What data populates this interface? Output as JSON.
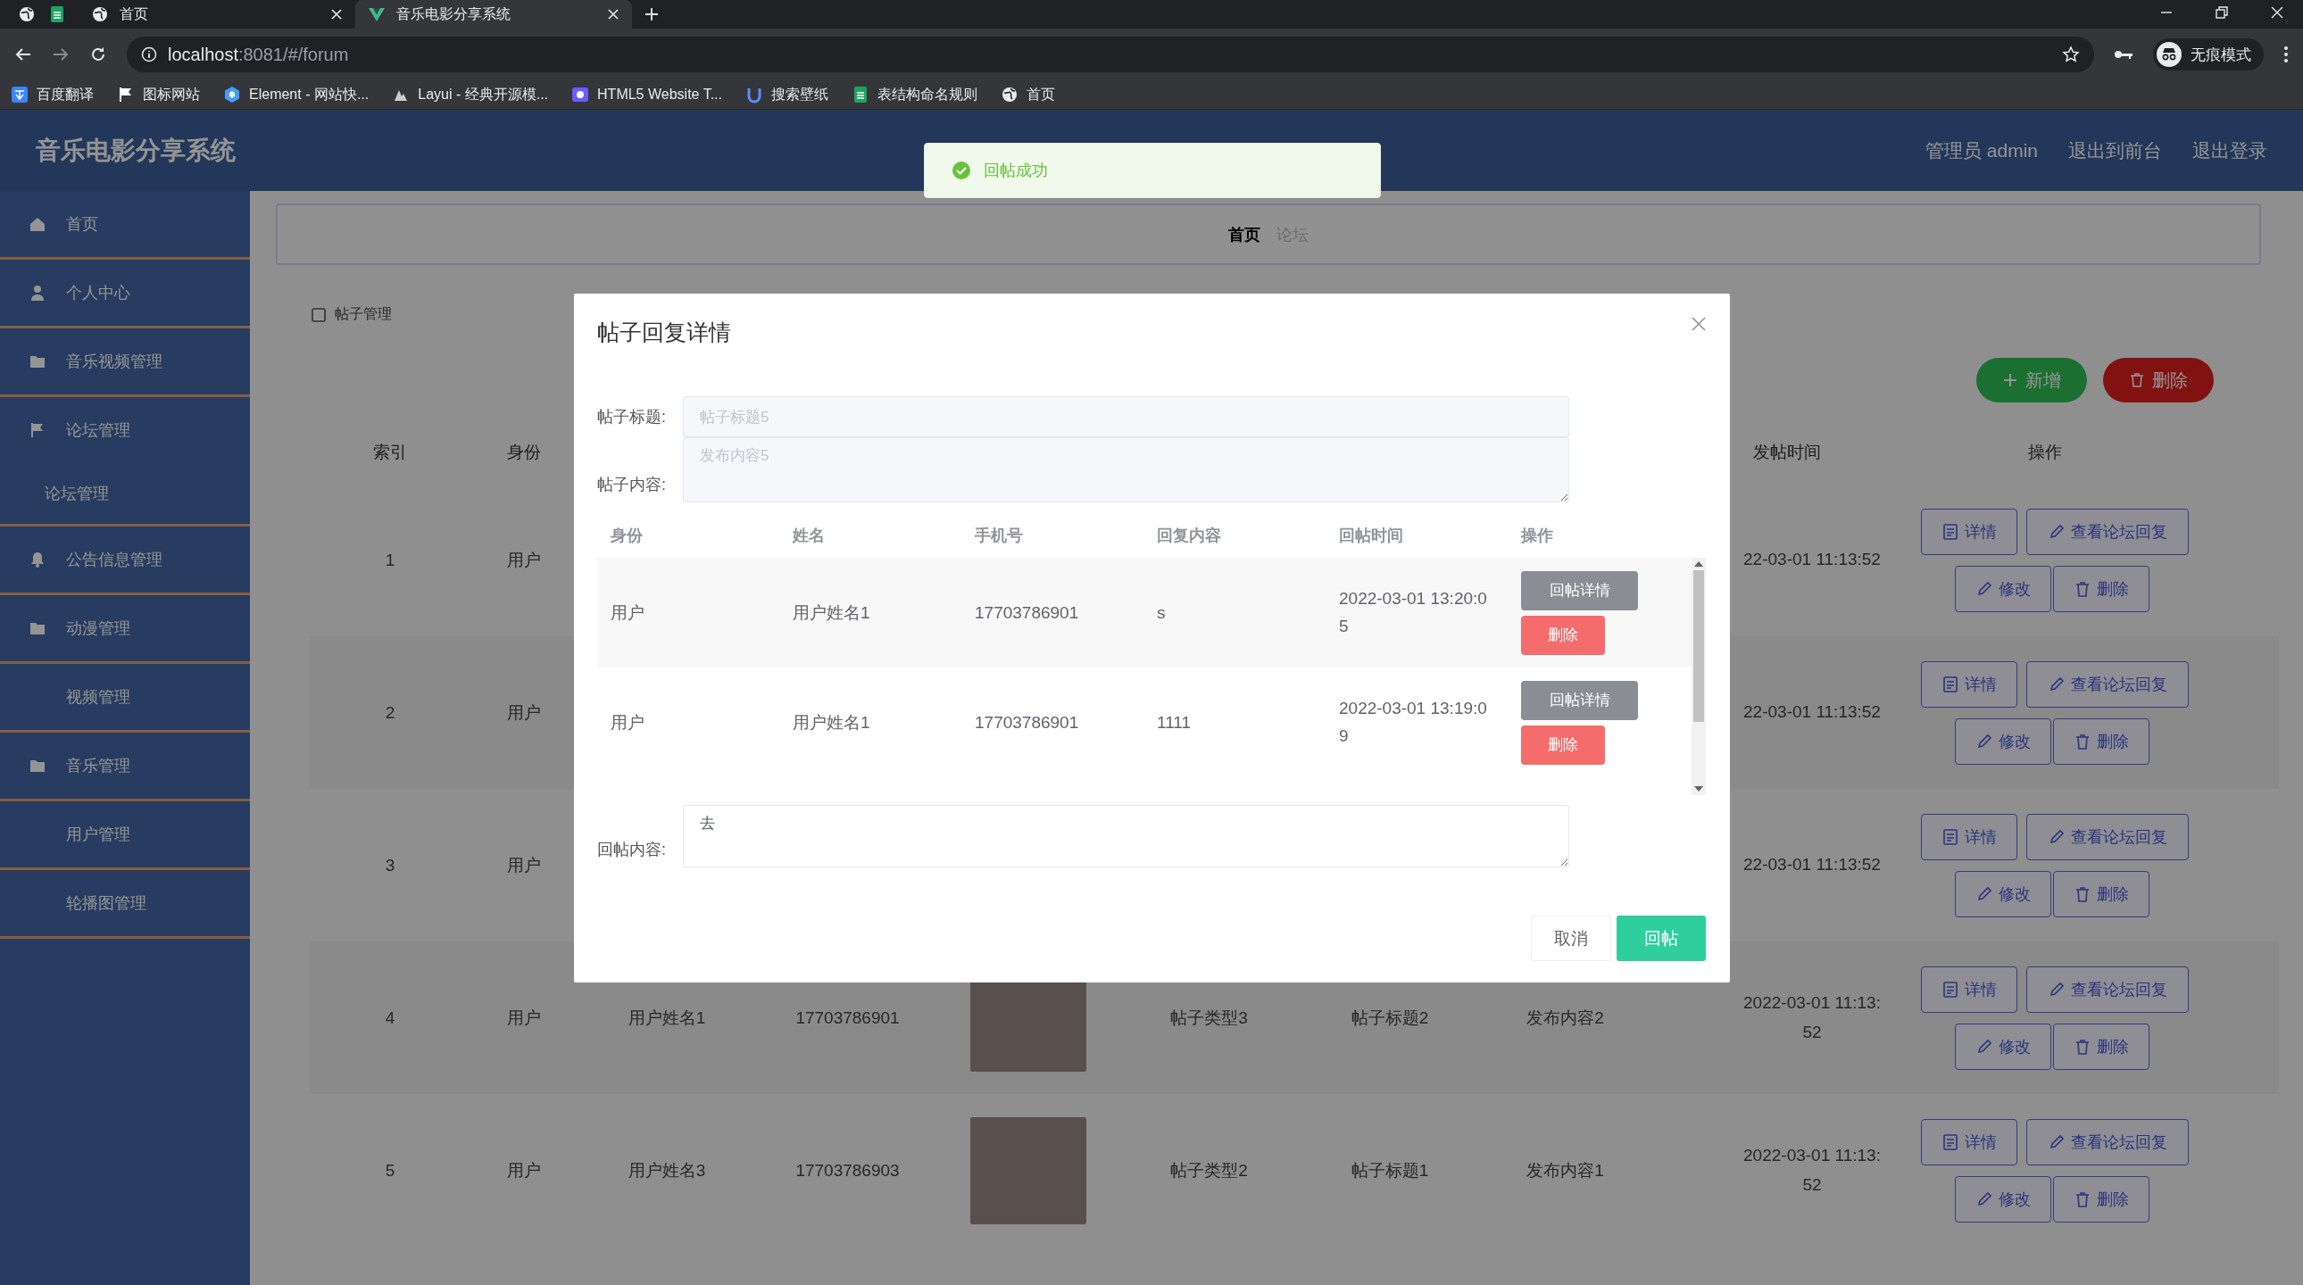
{
  "browser": {
    "tabs": [
      {
        "title": "首页",
        "selected": false
      },
      {
        "title": "音乐电影分享系统",
        "selected": true
      }
    ],
    "url": {
      "host": "localhost",
      "path": ":8081/#/forum"
    },
    "bookmarks": [
      "百度翻译",
      "图标网站",
      "Element - 网站快...",
      "Layui - 经典开源模...",
      "HTML5 Website T...",
      "搜索壁纸",
      "表结构命名规则",
      "首页"
    ],
    "profile": "无痕模式"
  },
  "app": {
    "title": "音乐电影分享系统",
    "header_links": [
      "管理员 admin",
      "退出到前台",
      "退出登录"
    ]
  },
  "toast": {
    "kind": "success",
    "message": "回帖成功"
  },
  "sidebar": {
    "items": [
      {
        "label": "首页"
      },
      {
        "label": "个人中心"
      },
      {
        "label": "音乐视频管理"
      },
      {
        "label": "论坛管理",
        "expanded": true,
        "children": [
          {
            "label": "论坛管理"
          }
        ]
      },
      {
        "label": "公告信息管理"
      },
      {
        "label": "动漫管理"
      },
      {
        "label": "视频管理"
      },
      {
        "label": "音乐管理"
      },
      {
        "label": "用户管理"
      },
      {
        "label": "轮播图管理"
      }
    ]
  },
  "breadcrumb": [
    "首页",
    "论坛"
  ],
  "section_label": "帖子管理",
  "toolbar": [
    {
      "label": "新增",
      "kind": "add"
    },
    {
      "label": "删除",
      "kind": "delete"
    }
  ],
  "table": {
    "headers": {
      "index": "索引",
      "identity": "身份",
      "time": "发帖时间",
      "actions": "操作"
    },
    "rows": [
      {
        "index": "1",
        "identity": "用户",
        "time": "22-03-01 11:13:52",
        "actions": [
          "详情",
          "查看论坛回复",
          "修改",
          "删除"
        ]
      },
      {
        "index": "2",
        "identity": "用户",
        "time": "22-03-01 11:13:52",
        "actions": [
          "详情",
          "查看论坛回复",
          "修改",
          "删除"
        ]
      },
      {
        "index": "3",
        "identity": "用户",
        "time": "22-03-01 11:13:52",
        "actions": [
          "详情",
          "查看论坛回复",
          "修改",
          "删除"
        ]
      },
      {
        "index": "4",
        "identity": "用户",
        "name": "用户姓名1",
        "phone": "17703786901",
        "image": true,
        "type": "帖子类型3",
        "title": "帖子标题2",
        "content": "发布内容2",
        "time": "2022-03-01 11:13:52",
        "actions": [
          "详情",
          "查看论坛回复",
          "修改",
          "删除"
        ]
      },
      {
        "index": "5",
        "identity": "用户",
        "name": "用户姓名3",
        "phone": "17703786903",
        "image": true,
        "type": "帖子类型2",
        "title": "帖子标题1",
        "content": "发布内容1",
        "time": "2022-03-01 11:13:52",
        "actions": [
          "详情",
          "查看论坛回复",
          "修改",
          "删除"
        ]
      }
    ]
  },
  "modal": {
    "title": "帖子回复详情",
    "fields": [
      {
        "label": "帖子标题:",
        "value": "帖子标题5",
        "kind": "input"
      },
      {
        "label": "帖子内容:",
        "value": "发布内容5",
        "kind": "textarea"
      }
    ],
    "replies": {
      "columns": [
        "身份",
        "姓名",
        "手机号",
        "回复内容",
        "回帖时间",
        "操作"
      ],
      "rows": [
        {
          "identity": "用户",
          "name": "用户姓名1",
          "phone": "17703786901",
          "content": "s",
          "time": "2022-03-01 13:20:05",
          "actions": [
            {
              "label": "回帖详情",
              "kind": "info"
            },
            {
              "label": "删除",
              "kind": "danger"
            }
          ]
        },
        {
          "identity": "用户",
          "name": "用户姓名1",
          "phone": "17703786901",
          "content": "1111",
          "time": "2022-03-01 13:19:09",
          "actions": [
            {
              "label": "回帖详情",
              "kind": "info"
            },
            {
              "label": "删除",
              "kind": "danger"
            }
          ]
        }
      ]
    },
    "reply_field": {
      "label": "回帖内容:",
      "value": "去"
    },
    "buttons": [
      {
        "label": "取消",
        "kind": "default"
      },
      {
        "label": "回帖",
        "kind": "primary"
      }
    ]
  }
}
